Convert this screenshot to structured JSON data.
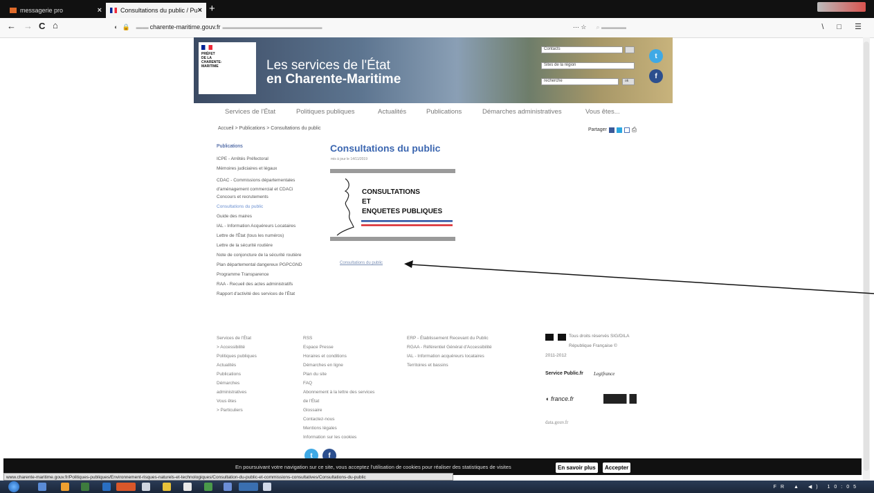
{
  "browser": {
    "tabs": [
      {
        "label": "messagerie pro",
        "close": "×"
      },
      {
        "label": "Consultations du public / Pu",
        "close": "×"
      }
    ],
    "new_tab": "+",
    "url_domain": "charente-maritime.gouv.fr",
    "nav": {
      "back": "←",
      "forward": "→",
      "reload": "C",
      "home": "⌂"
    },
    "nav_icons_right": "⋯ ☆",
    "toolbar_right": "\\ □ ☰",
    "status_url": "www.charente-maritime.gouv.fr/Politiques-publiques/Environnement-risques-naturels-et-technologiques/Consultation-du-public-et-commissions-consultatives/Consultations-du-public"
  },
  "banner": {
    "logo_lines": [
      "PRÉFET",
      "DE LA",
      "CHARENTE-",
      "MARITIME"
    ],
    "title_line1": "Les services de l'État",
    "title_line2": "en Charente-Maritime",
    "field_contact": "Contacts",
    "field_sites": "Sites de la région",
    "field_search": "recherche",
    "go": "ok",
    "twitter_glyph": "t",
    "facebook_glyph": "f"
  },
  "menu": [
    "Services de l'État",
    "Politiques publiques",
    "Actualités",
    "Publications",
    "Démarches administratives",
    "Vous êtes..."
  ],
  "breadcrumb": "Accueil > Publications > Consultations du public",
  "share": {
    "label": "Partager",
    "print": "⎙"
  },
  "sidebar": {
    "heading": "Publications",
    "items": [
      {
        "label": "ICPE - Arrêtés Préfectoral",
        "active": false
      },
      {
        "label": "Mémoires judiciaires et légaux",
        "active": false
      },
      {
        "label": "CDAC - Commissions départementales d'aménagement commercial et CDACi",
        "active": false
      },
      {
        "label": "Concours et recrutements",
        "active": false
      },
      {
        "label": "Consultations du public",
        "active": true
      },
      {
        "label": "Guide des maires",
        "active": false
      },
      {
        "label": "IAL - Information Acquéreurs Locataires",
        "active": false
      },
      {
        "label": "Lettre de l'État (tous les numéros)",
        "active": false
      },
      {
        "label": "Lettre de la sécurité routière",
        "active": false
      },
      {
        "label": "Note de conjoncture de la sécurité routière",
        "active": false
      },
      {
        "label": "Plan départemental dangereux PGPCGND",
        "active": false
      },
      {
        "label": "Programme Transparence",
        "active": false
      },
      {
        "label": "RAA - Recueil des actes administratifs",
        "active": false
      },
      {
        "label": "Rapport d'activité des services de l'État",
        "active": false
      }
    ]
  },
  "main": {
    "title": "Consultations du public",
    "date": "mis à jour le 14/11/2019",
    "illus_line1": "CONSULTATIONS",
    "illus_line2": "ET",
    "illus_line3": "ENQUETES PUBLIQUES",
    "doc_link": "Consultations du public"
  },
  "footer": {
    "col1": [
      "Services de l'État",
      "> Accessibilité",
      "Politiques publiques",
      "Actualités",
      "Publications",
      "Démarches",
      "administratives",
      "Vous êtes",
      "> Particuliers"
    ],
    "col2": [
      "RSS",
      "Espace Presse",
      "Horaires et conditions",
      "Démarches en ligne",
      "Plan du site",
      "FAQ",
      "Abonnement à la lettre des services",
      "de l'État",
      "Glossaire",
      "Contactez-nous",
      "Mentions légales",
      "Information sur les cookies"
    ],
    "col3": [
      "ERP - Établissement Recevant du Public",
      "RGAA - Référentiel Général d'Accessibilité",
      "IAL - Information acquéreurs locataires",
      "Territoires et bassins"
    ],
    "rights": "Tous droits réservés SIG/DILA",
    "republique": "République Française ©",
    "years": "2011-2012",
    "partners": {
      "service_public": "Service Public.fr",
      "legifrance": "Legifrance",
      "france": "france.fr",
      "data": "data.gouv.fr"
    },
    "social_twitter": "t",
    "social_facebook": "f"
  },
  "cookie": {
    "text": "En poursuivant votre navigation sur ce site, vous acceptez l'utilisation de cookies pour réaliser des statistiques de visites",
    "more_btn": "En savoir plus",
    "accept_btn": "Accepter"
  },
  "taskbar": {
    "tray": "FR ▲ ◀) 10:05"
  }
}
